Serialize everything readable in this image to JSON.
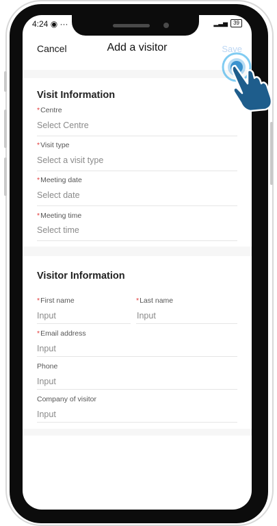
{
  "status": {
    "time": "4:24",
    "battery": "39"
  },
  "nav": {
    "cancel": "Cancel",
    "title": "Add a visitor",
    "save": "Save"
  },
  "visit": {
    "title": "Visit Information",
    "fields": [
      {
        "label": "Centre",
        "required": true,
        "placeholder": "Select Centre"
      },
      {
        "label": "Visit type",
        "required": true,
        "placeholder": "Select a visit type"
      },
      {
        "label": "Meeting date",
        "required": true,
        "placeholder": "Select date"
      },
      {
        "label": "Meeting time",
        "required": true,
        "placeholder": "Select time"
      }
    ]
  },
  "visitor": {
    "title": "Visitor Information",
    "first_name": {
      "label": "First name",
      "required": true,
      "placeholder": "Input"
    },
    "last_name": {
      "label": "Last name",
      "required": true,
      "placeholder": "Input"
    },
    "email": {
      "label": "Email address",
      "required": true,
      "placeholder": "Input"
    },
    "phone": {
      "label": "Phone",
      "required": false,
      "placeholder": "Input"
    },
    "company": {
      "label": "Company of visitor",
      "required": false,
      "placeholder": "Input"
    }
  },
  "required_mark": "*",
  "colors": {
    "accent_disabled": "#bcd6f3",
    "required": "#e23b3b",
    "hint": "#8a8a8a"
  }
}
